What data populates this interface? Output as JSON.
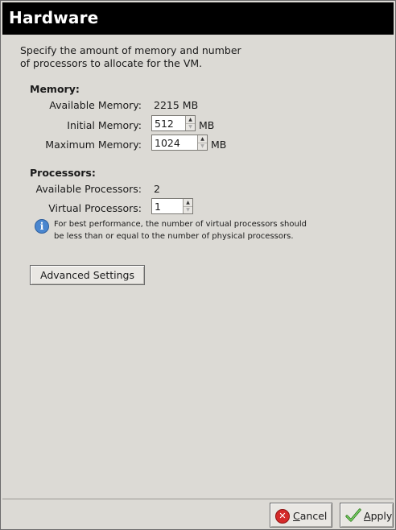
{
  "window": {
    "title": "Hardware"
  },
  "description": {
    "line1": "Specify the amount of memory and number",
    "line2": "of processors to allocate for the VM."
  },
  "memory": {
    "section_label": "Memory:",
    "available_label": "Available Memory:",
    "available_value": "2215 MB",
    "initial_label": "Initial Memory:",
    "initial_value": "512",
    "initial_unit": "MB",
    "maximum_label": "Maximum Memory:",
    "maximum_value": "1024",
    "maximum_unit": "MB"
  },
  "processors": {
    "section_label": "Processors:",
    "available_label": "Available Processors:",
    "available_value": "2",
    "virtual_label": "Virtual Processors:",
    "virtual_value": "1",
    "hint_line1": "For best performance, the number of virtual processors should",
    "hint_line2": "be less than or equal to the number of physical processors."
  },
  "advanced_button": {
    "label": "Advanced Settings"
  },
  "footer": {
    "cancel_mnemonic": "C",
    "cancel_rest": "ancel",
    "apply_mnemonic": "A",
    "apply_rest": "pply"
  },
  "icons": {
    "info": "info-icon",
    "cancel": "cancel-icon",
    "apply": "checkmark-icon",
    "spin_up": "spin-up-arrow-icon",
    "spin_down": "spin-down-arrow-icon"
  },
  "colors": {
    "titlebar_bg": "#000000",
    "titlebar_fg": "#ffffff",
    "panel_bg": "#dcdad5",
    "info_blue": "#4a86cf",
    "cancel_red": "#d42a2a",
    "apply_green": "#3a9a2a"
  }
}
